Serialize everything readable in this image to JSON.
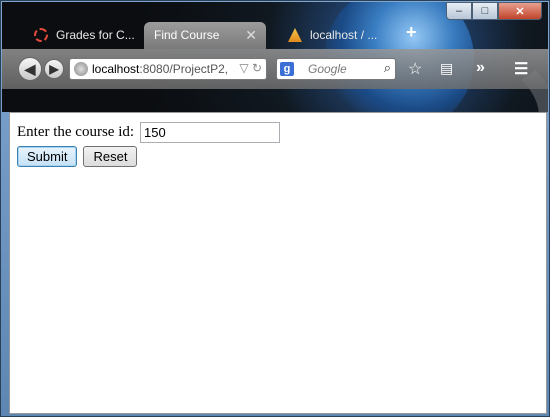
{
  "tabs": [
    {
      "label": "Grades for C...",
      "icon": "ring-icon",
      "active": false
    },
    {
      "label": "Find Course",
      "icon": "",
      "active": true
    },
    {
      "label": "localhost / ...",
      "icon": "pma-icon",
      "active": false
    }
  ],
  "window_controls": {
    "minimize": "–",
    "maximize": "□",
    "close": "✕"
  },
  "navbar": {
    "url_host": "localhost",
    "url_path": ":8080/ProjectP2,",
    "search_engine_letter": "g",
    "search_placeholder": "Google"
  },
  "form": {
    "label": "Enter the course id:",
    "course_id_value": "150",
    "submit_label": "Submit",
    "reset_label": "Reset"
  },
  "colors": {
    "accent_focus": "#3c7fb1",
    "chrome_dark": "#0b0d10"
  }
}
